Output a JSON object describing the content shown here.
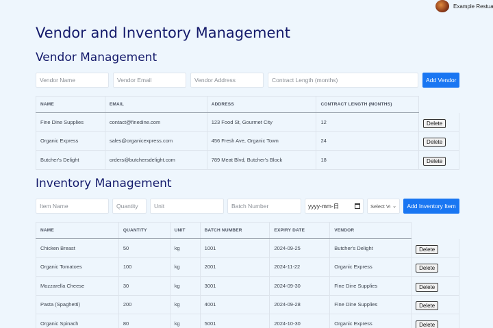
{
  "user": {
    "name": "Example Restuarant"
  },
  "page_title": "Vendor and Inventory Management",
  "vendor": {
    "heading": "Vendor Management",
    "placeholders": {
      "name": "Vendor Name",
      "email": "Vendor Email",
      "address": "Vendor Address",
      "contract": "Contract Length (months)"
    },
    "add_label": "Add Vendor",
    "columns": [
      "NAME",
      "EMAIL",
      "ADDRESS",
      "CONTRACT LENGTH (MONTHS)"
    ],
    "rows": [
      [
        "Fine Dine Supplies",
        "contact@finedine.com",
        "123 Food St, Gourmet City",
        "12"
      ],
      [
        "Organic Express",
        "sales@organicexpress.com",
        "456 Fresh Ave, Organic Town",
        "24"
      ],
      [
        "Butcher's Delight",
        "orders@butchersdelight.com",
        "789 Meat Blvd, Butcher's Block",
        "18"
      ]
    ]
  },
  "inventory": {
    "heading": "Inventory Management",
    "placeholders": {
      "item": "Item Name",
      "quantity": "Quantity",
      "unit": "Unit",
      "batch": "Batch Number"
    },
    "date_value": "yyyy-mm-日",
    "select_value": "Select Vendor",
    "add_label": "Add Inventory Item",
    "columns": [
      "NAME",
      "QUANTITY",
      "UNIT",
      "BATCH NUMBER",
      "EXPIRY DATE",
      "VENDOR"
    ],
    "rows": [
      [
        "Chicken Breast",
        "50",
        "kg",
        "1001",
        "2024-09-25",
        "Butcher's Delight"
      ],
      [
        "Organic Tomatoes",
        "100",
        "kg",
        "2001",
        "2024-11-22",
        "Organic Express"
      ],
      [
        "Mozzarella Cheese",
        "30",
        "kg",
        "3001",
        "2024-09-30",
        "Fine Dine Supplies"
      ],
      [
        "Pasta (Spaghetti)",
        "200",
        "kg",
        "4001",
        "2024-09-28",
        "Fine Dine Supplies"
      ],
      [
        "Organic Spinach",
        "80",
        "kg",
        "5001",
        "2024-10-30",
        "Organic Express"
      ]
    ]
  },
  "delete_label": "Delete"
}
